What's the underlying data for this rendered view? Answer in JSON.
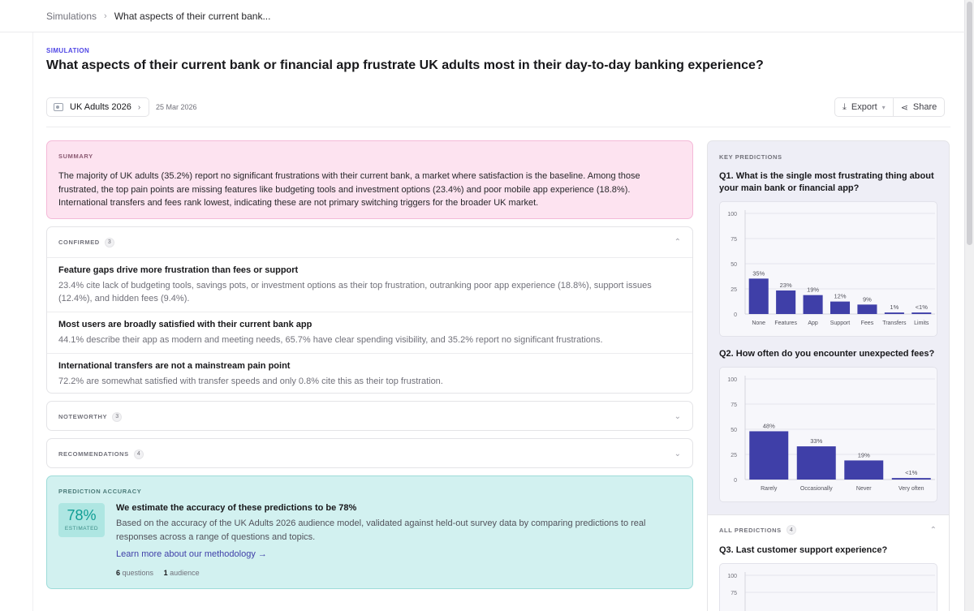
{
  "breadcrumb": {
    "root": "Simulations",
    "current": "What aspects of their current bank..."
  },
  "eyebrow": "SIMULATION",
  "title": "What aspects of their current bank or financial app frustrate UK adults most in their day-to-day banking experience?",
  "audience": {
    "label": "UK Adults 2026",
    "date": "25 Mar 2026"
  },
  "actions": {
    "export": "Export",
    "share": "Share"
  },
  "summary": {
    "label": "SUMMARY",
    "text": "The majority of UK adults (35.2%) report no significant frustrations with their current bank, a market where satisfaction is the baseline. Among those frustrated, the top pain points are missing features like budgeting tools and investment options (23.4%) and poor mobile app experience (18.8%). International transfers and fees rank lowest, indicating these are not primary switching triggers for the broader UK market."
  },
  "confirmed": {
    "label": "CONFIRMED",
    "count": "3",
    "items": [
      {
        "title": "Feature gaps drive more frustration than fees or support",
        "text": "23.4% cite lack of budgeting tools, savings pots, or investment options as their top frustration, outranking poor app experience (18.8%), support issues (12.4%), and hidden fees (9.4%)."
      },
      {
        "title": "Most users are broadly satisfied with their current bank app",
        "text": "44.1% describe their app as modern and meeting needs, 65.7% have clear spending visibility, and 35.2% report no significant frustrations."
      },
      {
        "title": "International transfers are not a mainstream pain point",
        "text": "72.2% are somewhat satisfied with transfer speeds and only 0.8% cite this as their top frustration."
      }
    ]
  },
  "noteworthy": {
    "label": "NOTEWORTHY",
    "count": "3"
  },
  "recommendations": {
    "label": "RECOMMENDATIONS",
    "count": "4"
  },
  "accuracy": {
    "label": "PREDICTION ACCURACY",
    "value": "78%",
    "estimated": "ESTIMATED",
    "title": "We estimate the accuracy of these predictions to be 78%",
    "text": "Based on the accuracy of the UK Adults 2026 audience model, validated against held-out survey data by comparing predictions to real responses across a range of questions and topics.",
    "link": "Learn more about our methodology →",
    "questions_count": "6",
    "questions_label": "questions",
    "audience_count": "1",
    "audience_label": "audience"
  },
  "key_predictions": {
    "label": "KEY PREDICTIONS",
    "q1": "Q1. What is the single most frustrating thing about your main bank or financial app?",
    "q2": "Q2. How often do you encounter unexpected fees?",
    "q3": "Q3. Last customer support experience?"
  },
  "all_predictions": {
    "label": "ALL PREDICTIONS",
    "count": "4"
  },
  "colors": {
    "bar": "#3f3fa8",
    "accent": "#4f46e5",
    "summary_bg": "#fde3f0",
    "accuracy_bg": "#d2f1f0"
  },
  "chart_data": [
    {
      "type": "bar",
      "categories": [
        "None",
        "Features",
        "App",
        "Support",
        "Fees",
        "Transfers",
        "Limits"
      ],
      "values": [
        35.2,
        23.4,
        18.8,
        12.4,
        9.4,
        0.8,
        0.4
      ],
      "labels": [
        "35%",
        "23%",
        "19%",
        "12%",
        "9%",
        "1%",
        "<1%"
      ],
      "ylim": [
        0,
        100
      ],
      "yticks": [
        0,
        25,
        50,
        75,
        100
      ]
    },
    {
      "type": "bar",
      "categories": [
        "Rarely",
        "Occasionally",
        "Never",
        "Very often"
      ],
      "values": [
        48,
        33,
        19,
        0.5
      ],
      "labels": [
        "48%",
        "33%",
        "19%",
        "<1%"
      ],
      "ylim": [
        0,
        100
      ],
      "yticks": [
        0,
        25,
        50,
        75,
        100
      ]
    },
    {
      "type": "bar",
      "categories": [],
      "values": [],
      "ylim": [
        0,
        100
      ],
      "yticks": [
        75,
        100
      ]
    }
  ]
}
